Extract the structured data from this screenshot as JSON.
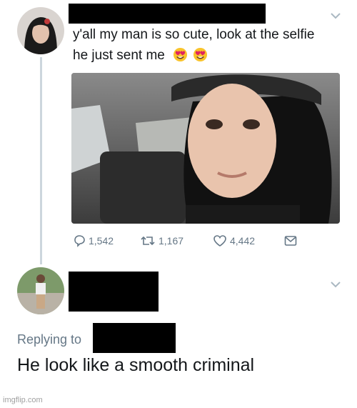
{
  "tweet": {
    "text_line1": "y'all my man is so cute, look at the selfie",
    "text_line2": "he just sent me",
    "emoji_name": "heart-eyes-emoji",
    "stats": {
      "replies": "1,542",
      "retweets": "1,167",
      "likes": "4,442"
    }
  },
  "reply": {
    "replying_to_label": "Replying to",
    "text": "He look like a smooth criminal"
  },
  "watermark": "imgflip.com",
  "colors": {
    "thread_line": "#ccd6dd",
    "secondary_text": "#657786",
    "redaction": "#000000"
  },
  "icons": [
    "chevron-down-icon",
    "reply-icon",
    "retweet-icon",
    "like-icon",
    "dm-icon"
  ]
}
